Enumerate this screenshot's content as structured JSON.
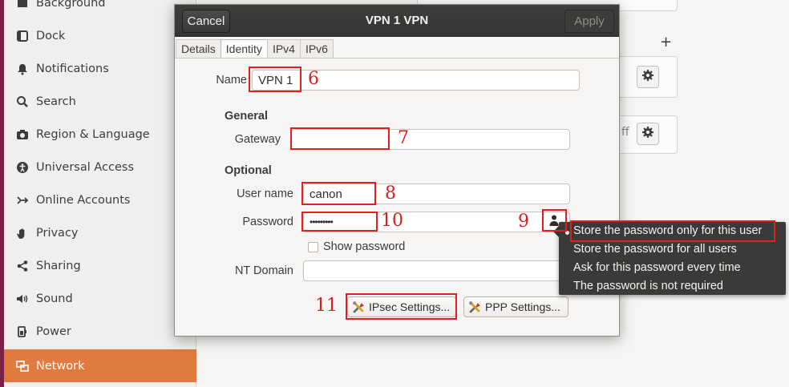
{
  "sidebar": {
    "items": [
      {
        "label": "Background",
        "icon": "background-icon"
      },
      {
        "label": "Dock",
        "icon": "dock-icon"
      },
      {
        "label": "Notifications",
        "icon": "bell-icon"
      },
      {
        "label": "Search",
        "icon": "search-icon"
      },
      {
        "label": "Region & Language",
        "icon": "camera-icon"
      },
      {
        "label": "Universal Access",
        "icon": "accessibility-icon"
      },
      {
        "label": "Online Accounts",
        "icon": "share-icon"
      },
      {
        "label": "Privacy",
        "icon": "hand-icon"
      },
      {
        "label": "Sharing",
        "icon": "sharing-icon"
      },
      {
        "label": "Sound",
        "icon": "speaker-icon"
      },
      {
        "label": "Power",
        "icon": "power-icon"
      },
      {
        "label": "Network",
        "icon": "network-icon",
        "selected": true
      }
    ]
  },
  "background": {
    "plus_label": "+",
    "off_fragment": "ff"
  },
  "dialog": {
    "cancel_label": "Cancel",
    "title": "VPN 1 VPN",
    "apply_label": "Apply",
    "tabs": [
      {
        "label": "Details"
      },
      {
        "label": "Identity",
        "active": true
      },
      {
        "label": "IPv4"
      },
      {
        "label": "IPv6"
      }
    ],
    "name_label": "Name",
    "name_value": "VPN 1",
    "general_heading": "General",
    "gateway_label": "Gateway",
    "gateway_value": "",
    "optional_heading": "Optional",
    "username_label": "User name",
    "username_value": "canon",
    "password_label": "Password",
    "password_value": "•••••••••",
    "show_password_label": "Show password",
    "show_password_checked": false,
    "nt_domain_label": "NT Domain",
    "nt_domain_value": "",
    "ipsec_button_label": "IPsec Settings...",
    "ppp_button_label": "PPP Settings..."
  },
  "password_menu": {
    "items": [
      {
        "label": "Store the password only for this user",
        "selected": true
      },
      {
        "label": "Store the password for all users"
      },
      {
        "label": "Ask for this password every time"
      },
      {
        "label": "The password is not required"
      }
    ]
  },
  "annotations": {
    "n6": "6",
    "n7": "7",
    "n8": "8",
    "n9": "9",
    "n10": "10",
    "n11": "11"
  },
  "colors": {
    "accent": "#e07a3e",
    "headerbar": "#3a3937",
    "annotation_red": "#e02020"
  }
}
